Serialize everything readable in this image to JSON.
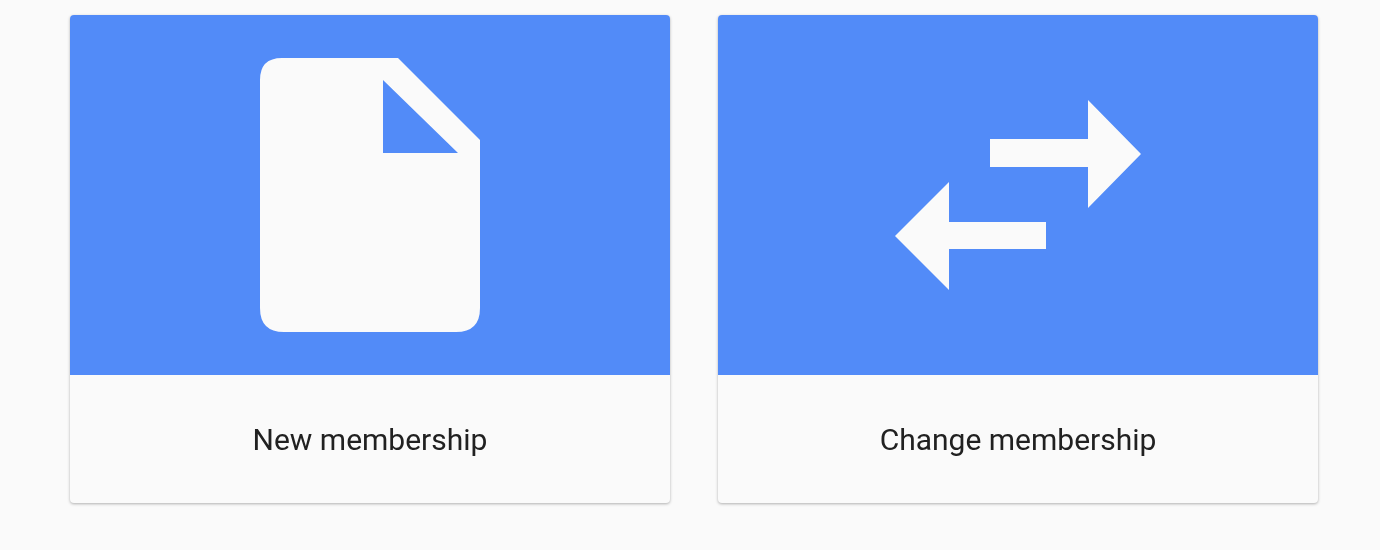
{
  "cards": [
    {
      "kind": "new",
      "label": "New membership"
    },
    {
      "kind": "change",
      "label": "Change membership"
    }
  ]
}
